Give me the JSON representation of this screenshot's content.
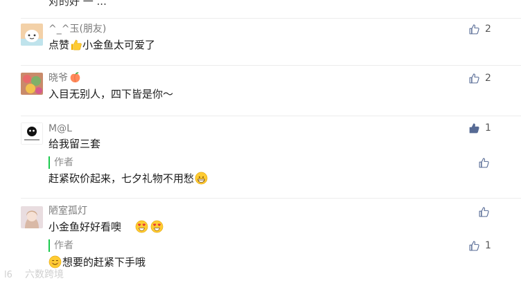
{
  "top_partial_text": "对的好 一 ...",
  "comments": [
    {
      "name": "^_^玉(朋友)",
      "text_before_icon": "点赞",
      "text_after_icon": "小金鱼太可爱了",
      "likes": "2"
    },
    {
      "name": "晓爷",
      "text": "入目无别人，四下皆是你～",
      "likes": "2"
    },
    {
      "name": "M@L",
      "text": "给我留三套",
      "likes": "1",
      "reply": {
        "tag": "作者",
        "text": "赶紧砍价起来，七夕礼物不用愁"
      }
    },
    {
      "name": "陋室孤灯",
      "text": "小金鱼好好看噢",
      "reply": {
        "tag": "作者",
        "text": "想要的赶紧下手哦",
        "likes": "1"
      }
    }
  ],
  "watermark": "六数跨境",
  "colors": {
    "author_bar": "#19c94c",
    "liked_icon": "#576b95"
  }
}
